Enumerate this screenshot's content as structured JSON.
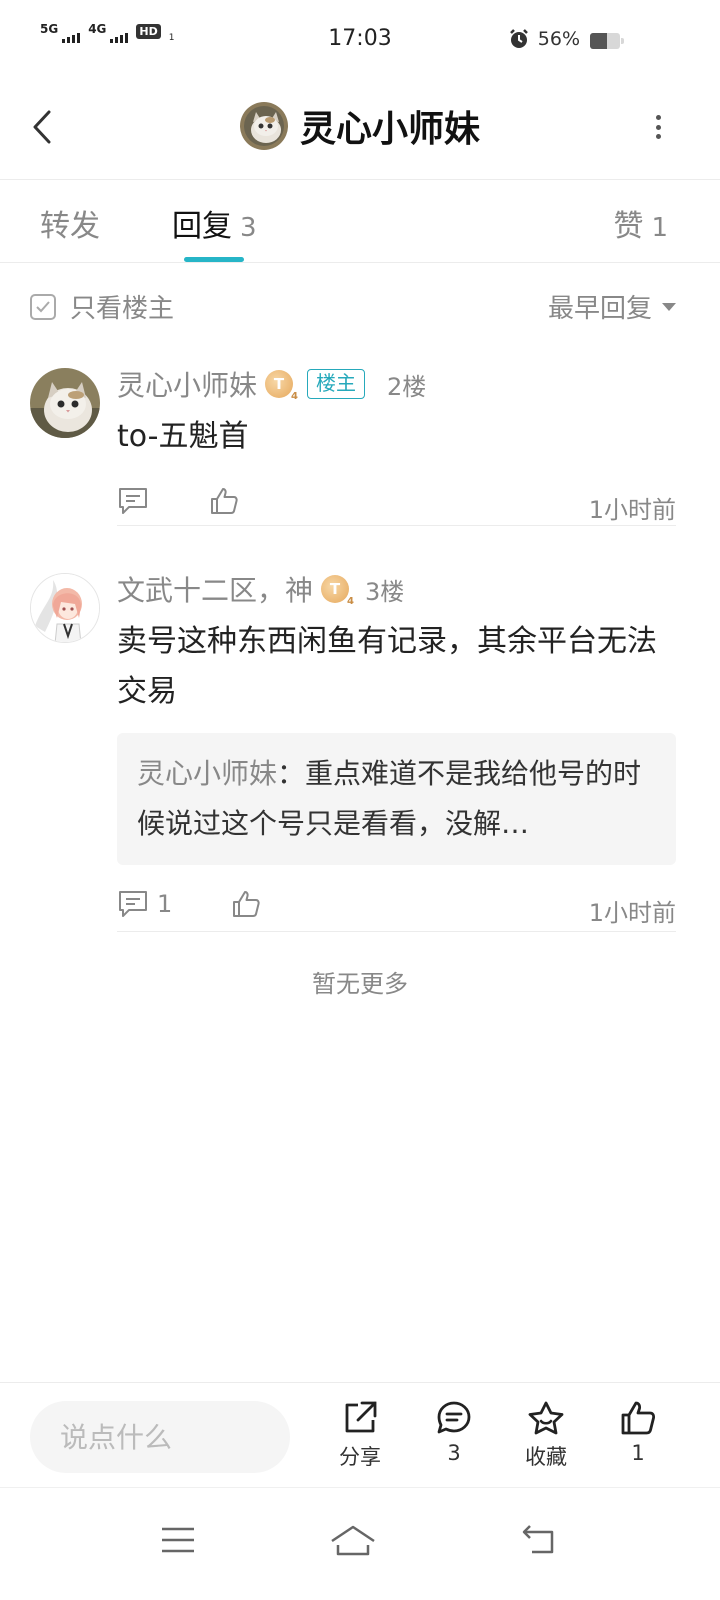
{
  "status_bar": {
    "signal1_label": "5G",
    "signal2_label": "4G",
    "hd_label": "HD",
    "hd_sub": "1",
    "time": "17:03",
    "battery_text": "56%",
    "battery_level": 0.56
  },
  "header": {
    "title": "灵心小师妹"
  },
  "tabs": [
    {
      "label": "转发",
      "count": ""
    },
    {
      "label": "回复",
      "count": "3"
    },
    {
      "label": "赞",
      "count": "1"
    }
  ],
  "filter": {
    "only_op_label": "只看楼主",
    "sort_label": "最早回复"
  },
  "posts": [
    {
      "username": "灵心小师妹",
      "level": "T",
      "level_sub": "4",
      "op_badge": "楼主",
      "floor": "2楼",
      "content": "to-五魁首",
      "comment_count": "",
      "time": "1小时前"
    },
    {
      "username": "文武十二区，神",
      "level": "T",
      "level_sub": "4",
      "floor": "3楼",
      "content": "卖号这种东西闲鱼有记录，其余平台无法交易",
      "quote_user": "灵心小师妹",
      "quote_text": "：重点难道不是我给他号的时候说过这个号只是看看，没解…",
      "comment_count": "1",
      "time": "1小时前"
    }
  ],
  "no_more_text": "暂无更多",
  "bottom_bar": {
    "input_placeholder": "说点什么",
    "share_label": "分享",
    "comment_count": "3",
    "collect_label": "收藏",
    "like_count": "1"
  },
  "colors": {
    "accent": "#26b5c7",
    "op_badge": "#26a9bb",
    "muted_text": "#888888",
    "level_badge": "#e6a85c"
  },
  "icons": [
    "back-icon",
    "more-icon",
    "checkbox-icon",
    "caret-down-icon",
    "comment-icon",
    "thumbs-up-icon",
    "share-icon",
    "star-icon",
    "menu-icon",
    "home-icon",
    "return-icon"
  ]
}
